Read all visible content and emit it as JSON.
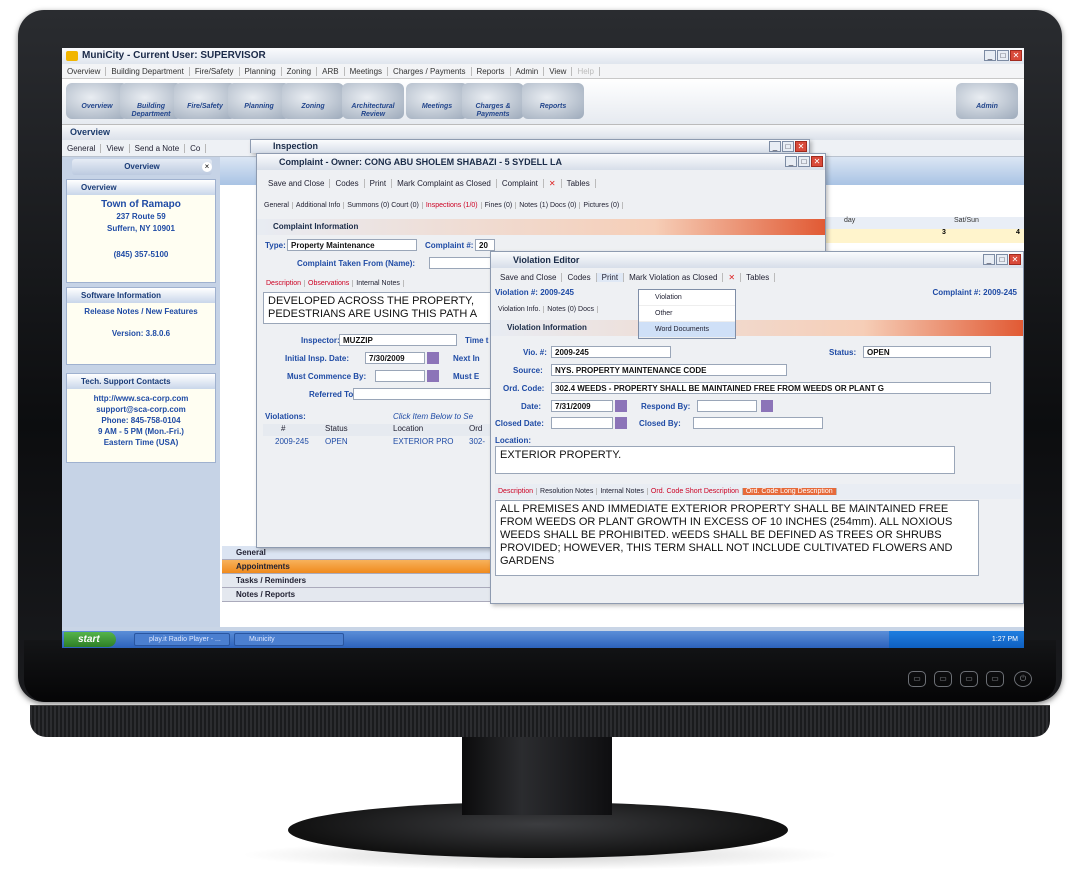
{
  "app": {
    "title": "MuniCity - Current User: SUPERVISOR",
    "menu": [
      "Overview",
      "Building Department",
      "Fire/Safety",
      "Planning",
      "Zoning",
      "ARB",
      "Meetings",
      "Charges / Payments",
      "Reports",
      "Admin",
      "View",
      "Help"
    ],
    "ribbon": [
      "Overview",
      "Building Department",
      "Fire/Safety",
      "Planning",
      "Zoning",
      "Architectural Review",
      "Meetings",
      "Charges & Payments",
      "Reports",
      "Admin"
    ],
    "section_label": "Overview",
    "toolstrip": [
      "General",
      "View",
      "Send a Note",
      "Co"
    ]
  },
  "sidebar": {
    "header": "Overview",
    "overview": {
      "title": "Overview",
      "org": "Town of Ramapo",
      "addr1": "237 Route 59",
      "addr2": "Suffern, NY 10901",
      "phone": "(845) 357-5100"
    },
    "software": {
      "title": "Software Information",
      "notes": "Release Notes / New Features",
      "version": "Version: 3.8.0.6"
    },
    "support": {
      "title": "Tech. Support Contacts",
      "web": "http://www.sca-corp.com",
      "email": "support@sca-corp.com",
      "phone": "Phone: 845-758-0104",
      "hours": "9 AM - 5 PM (Mon.-Fri.)",
      "tz": "Eastern Time (USA)"
    }
  },
  "calendar": {
    "col1": "day",
    "col2": "Sat/Sun",
    "n3": "3",
    "n4": "4"
  },
  "bottom_nav": [
    "General",
    "Appointments",
    "Tasks / Reminders",
    "Notes / Reports"
  ],
  "inspection": {
    "title": "Inspection"
  },
  "complaint": {
    "title": "Complaint - Owner: CONG ABU SHOLEM SHABAZI - 5 SYDELL LA",
    "toolbar": [
      "Save and Close",
      "Codes",
      "Print",
      "Mark Complaint as Closed",
      "Complaint",
      "Tables"
    ],
    "tabs": [
      "General",
      "Additional Info",
      "Summons (0) Court (0)",
      "Inspections (1/0)",
      "Fines (0)",
      "Notes (1) Docs (0)",
      "Pictures (0)"
    ],
    "section": "Complaint Information",
    "type_label": "Type:",
    "type_value": "Property Maintenance",
    "complaint_no_label": "Complaint #:",
    "complaint_no_value": "20",
    "taken_from_label": "Complaint Taken From (Name):",
    "desc_tabs": [
      "Description",
      "Observations",
      "Internal Notes"
    ],
    "desc_text": "DEVELOPED ACROSS THE PROPERTY, PEDESTRIANS ARE USING THIS PATH A",
    "inspector_label": "Inspector:",
    "inspector_value": "MUZZIP",
    "time_label": "Time t",
    "initial_label": "Initial Insp. Date:",
    "initial_value": "7/30/2009",
    "next_label": "Next In",
    "must_commence_label": "Must Commence By:",
    "must_label": "Must E",
    "referred_label": "Referred To:",
    "violations_label": "Violations:",
    "violations_hint": "Click Item Below to Se",
    "vcols": [
      "#",
      "Status",
      "Location",
      "Ord"
    ],
    "vrow": [
      "2009-245",
      "OPEN",
      "EXTERIOR PRO",
      "302-"
    ]
  },
  "violation": {
    "title": "Violation Editor",
    "toolbar": [
      "Save and Close",
      "Codes",
      "Print",
      "Mark Violation as Closed",
      "Tables"
    ],
    "violation_no": "Violation #: 2009-245",
    "complaint_no": "Complaint #: 2009-245",
    "tabs": [
      "Violation Info.",
      "Notes (0) Docs"
    ],
    "section": "Violation Information",
    "vio_label": "Vio. #:",
    "vio_value": "2009-245",
    "status_label": "Status:",
    "status_value": "OPEN",
    "source_label": "Source:",
    "source_value": "NYS. PROPERTY MAINTENANCE CODE",
    "ord_label": "Ord. Code:",
    "ord_value": "302.4 WEEDS - PROPERTY SHALL BE MAINTAINED FREE FROM WEEDS OR PLANT G",
    "date_label": "Date:",
    "date_value": "7/31/2009",
    "respond_label": "Respond By:",
    "closed_date_label": "Closed Date:",
    "closed_by_label": "Closed By:",
    "location_label": "Location:",
    "location_value": "EXTERIOR PROPERTY.",
    "desc_tabs": [
      "Description",
      "Resolution Notes",
      "Internal Notes",
      "Ord. Code Short Description",
      "Ord. Code Long Description"
    ],
    "long_desc": "ALL PREMISES AND IMMEDIATE EXTERIOR PROPERTY SHALL BE MAINTAINED FREE FROM WEEDS OR PLANT GROWTH IN EXCESS OF 10 INCHES (254mm).  ALL NOXIOUS WEEDS SHALL BE PROHIBITED.  wEEDS SHALL BE DEFINED AS TREES OR SHRUBS PROVIDED; HOWEVER, THIS TERM SHALL NOT INCLUDE CULTIVATED FLOWERS AND GARDENS",
    "print_menu": [
      "Violation",
      "Other",
      "Word Documents"
    ]
  },
  "taskbar": {
    "start": "start",
    "items": [
      "play.it Radio Player - ...",
      "Municity"
    ],
    "clock": "1:27 PM"
  },
  "monitor_buttons": [
    "menu",
    "auto",
    "input",
    "power"
  ]
}
